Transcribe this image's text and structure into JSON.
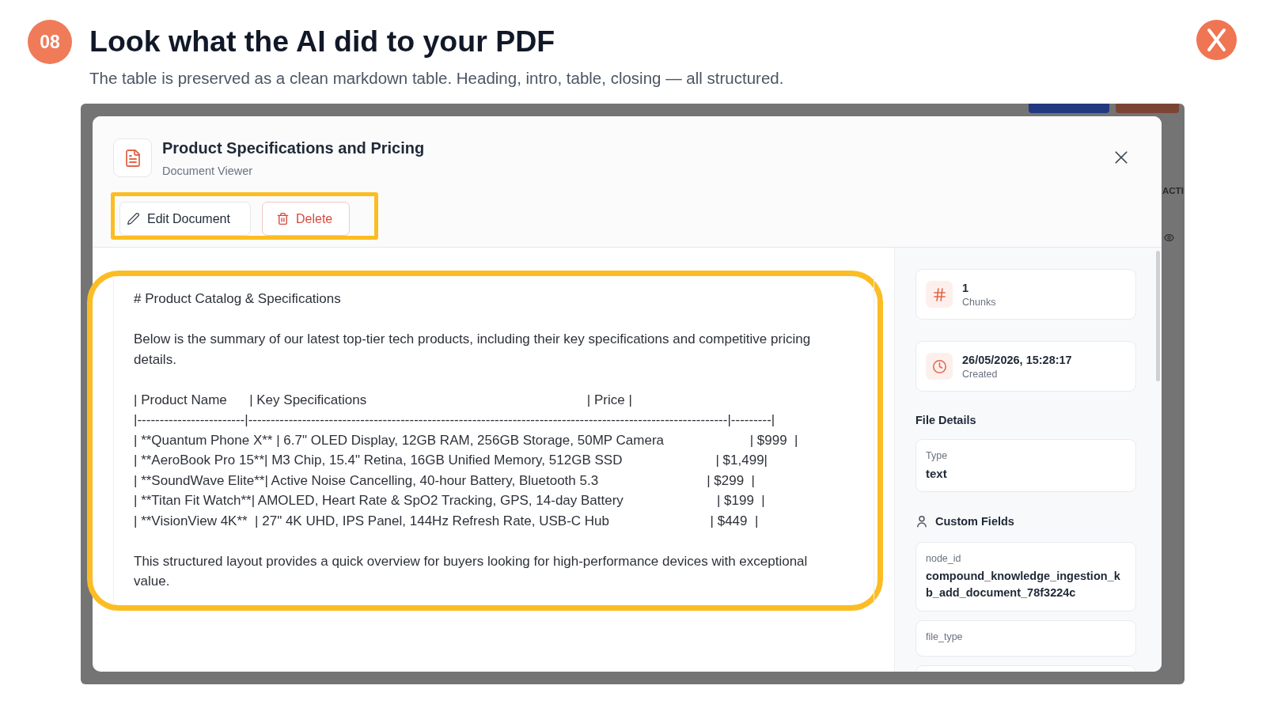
{
  "slide": {
    "step": "08",
    "title": "Look what the AI did to your PDF",
    "subtitle": "The table is preserved as a clean markdown table. Heading, intro, table, closing — all structured."
  },
  "backdrop": {
    "column_header": "ACTI"
  },
  "dialog": {
    "title": "Product Specifications and Pricing",
    "subtitle": "Document Viewer",
    "toolbar": {
      "highlighted": true,
      "buttons": [
        {
          "kind": "edit",
          "label": "Edit Document"
        },
        {
          "kind": "delete",
          "label": "Delete"
        }
      ]
    },
    "document": {
      "highlighted": true,
      "heading": "# Product Catalog & Specifications",
      "intro": "Below is the summary of our latest top-tier tech products, including their key specifications and competitive pricing details.",
      "table_lines": [
        "| Product Name      | Key Specifications                                                           | Price |",
        "|------------------------|-----------------------------------------------------------------------------------------------------------|---------|",
        "| **Quantum Phone X** | 6.7\" OLED Display, 12GB RAM, 256GB Storage, 50MP Camera                       | $999  |",
        "| **AeroBook Pro 15**| M3 Chip, 15.4\" Retina, 16GB Unified Memory, 512GB SSD                         | $1,499|",
        "| **SoundWave Elite**| Active Noise Cancelling, 40-hour Battery, Bluetooth 5.3                             | $299  |",
        "| **Titan Fit Watch**| AMOLED, Heart Rate & SpO2 Tracking, GPS, 14-day Battery                         | $199  |",
        "| **VisionView 4K**  | 27\" 4K UHD, IPS Panel, 144Hz Refresh Rate, USB-C Hub                           | $449  |"
      ],
      "closing": "This structured layout provides a quick overview for buyers looking for high-performance devices with exceptional value."
    },
    "sidebar": {
      "stats": [
        {
          "kind": "chunks",
          "value": "1",
          "label": "Chunks"
        },
        {
          "kind": "created",
          "value": "26/05/2026, 15:28:17",
          "label": "Created"
        }
      ],
      "file_details": {
        "title": "File Details",
        "fields": [
          {
            "label": "Type",
            "value": "text"
          }
        ]
      },
      "custom_fields": {
        "title": "Custom Fields",
        "fields": [
          {
            "label": "node_id",
            "value": "compound_knowledge_ingestion_kb_add_document_78f3224c"
          },
          {
            "label": "file_type"
          }
        ]
      }
    }
  }
}
